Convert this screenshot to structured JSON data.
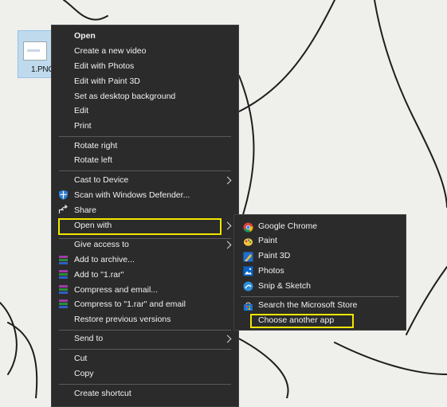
{
  "desktop": {
    "file_name": "1.PNG"
  },
  "context_menu": {
    "items": [
      {
        "label": "Open"
      },
      {
        "label": "Create a new video"
      },
      {
        "label": "Edit with Photos"
      },
      {
        "label": "Edit with Paint 3D"
      },
      {
        "label": "Set as desktop background"
      },
      {
        "label": "Edit"
      },
      {
        "label": "Print"
      },
      {
        "label": "Rotate right"
      },
      {
        "label": "Rotate left"
      },
      {
        "label": "Cast to Device"
      },
      {
        "label": "Scan with Windows Defender..."
      },
      {
        "label": "Share"
      },
      {
        "label": "Open with"
      },
      {
        "label": "Give access to"
      },
      {
        "label": "Add to archive..."
      },
      {
        "label": "Add to \"1.rar\""
      },
      {
        "label": "Compress and email..."
      },
      {
        "label": "Compress to \"1.rar\" and email"
      },
      {
        "label": "Restore previous versions"
      },
      {
        "label": "Send to"
      },
      {
        "label": "Cut"
      },
      {
        "label": "Copy"
      },
      {
        "label": "Create shortcut"
      }
    ]
  },
  "open_with_submenu": {
    "items": [
      {
        "label": "Google Chrome",
        "icon": "chrome-icon"
      },
      {
        "label": "Paint",
        "icon": "paint-icon"
      },
      {
        "label": "Paint 3D",
        "icon": "paint-3d-icon"
      },
      {
        "label": "Photos",
        "icon": "photos-icon"
      },
      {
        "label": "Snip & Sketch",
        "icon": "snip-sketch-icon"
      },
      {
        "label": "Search the Microsoft Store",
        "icon": "microsoft-store-icon"
      },
      {
        "label": "Choose another app"
      }
    ]
  },
  "colors": {
    "menu_bg": "#2b2b2b",
    "highlight": "#f2e600",
    "text": "#f2f2f2"
  }
}
